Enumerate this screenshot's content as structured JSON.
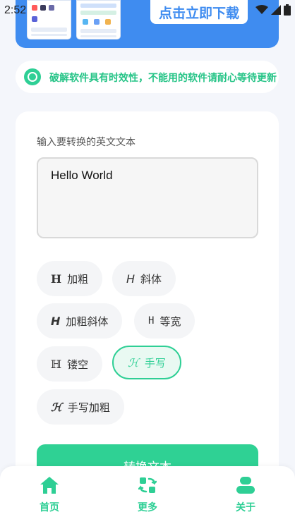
{
  "status_bar": {
    "time": "2:52"
  },
  "banner": {
    "download_label": "点击立即下载"
  },
  "notice": {
    "text": "破解软件具有时效性，不能用的软件请耐心等待更新"
  },
  "converter": {
    "input_label": "输入要转换的英文文本",
    "input_value": "Hello World",
    "styles": [
      {
        "glyph": "H",
        "label": "加粗"
      },
      {
        "glyph": "H",
        "label": "斜体"
      },
      {
        "glyph": "H",
        "label": "加粗斜体"
      },
      {
        "glyph": "H",
        "label": "等宽"
      },
      {
        "glyph": "ℍ",
        "label": "镂空"
      },
      {
        "glyph": "ℋ",
        "label": "手写"
      },
      {
        "glyph": "ℋ",
        "label": "手写加粗"
      }
    ],
    "selected_style": "手写",
    "convert_label": "转换文本"
  },
  "bottom_nav": {
    "items": [
      {
        "label": "首页",
        "icon": "home-icon"
      },
      {
        "label": "更多",
        "icon": "refresh-icon"
      },
      {
        "label": "关于",
        "icon": "user-icon"
      }
    ]
  },
  "colors": {
    "accent": "#2ecf95",
    "banner": "#3f8cf0"
  }
}
